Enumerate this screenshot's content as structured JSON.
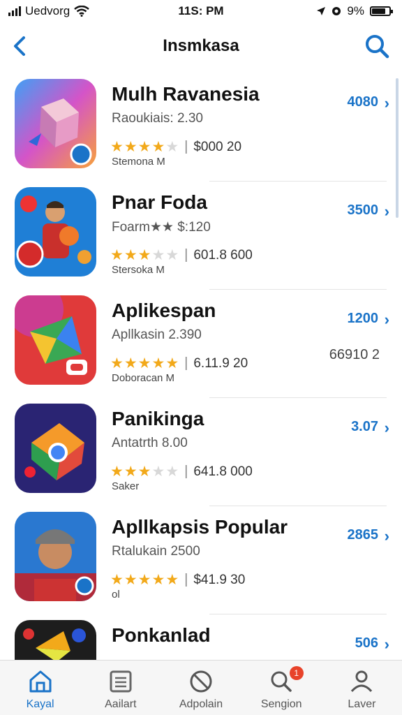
{
  "status_bar": {
    "carrier": "Uedvorg",
    "time": "11S: PM",
    "battery_text": "9%",
    "battery_level_fraction": 0.8
  },
  "header": {
    "title": "Insmkasa",
    "back_icon": "chevron-left-icon",
    "search_icon": "search-icon"
  },
  "apps": [
    {
      "name": "Mulh Ravanesia",
      "subtitle": "Raoukiais:  2.30",
      "stars": 4.5,
      "price": "$000  20",
      "category": "Stemona  M",
      "count": "4080",
      "extra": "",
      "icon_name": "cube-app-icon"
    },
    {
      "name": "Pnar Foda",
      "subtitle": "Foarm★★  $:120",
      "stars": 3,
      "price": "601.8  600",
      "category": "Stersoka  M",
      "count": "3500",
      "extra": "",
      "icon_name": "character-app-icon"
    },
    {
      "name": "Aplikespan",
      "subtitle": "Apllkasin  2.390",
      "stars": 5,
      "price": "6.11.9  20",
      "category": "Doboracan  M",
      "count": "1200",
      "extra": "66910 2",
      "icon_name": "triangle-app-icon"
    },
    {
      "name": "Panikinga",
      "subtitle": "Antatrth  8.00",
      "stars": 3.5,
      "price": "641.8  000",
      "category": "Saker",
      "count": "3.07",
      "extra": "",
      "icon_name": "cube-chrome-app-icon"
    },
    {
      "name": "Apllkapsis Popular",
      "subtitle": "Rtalukain  2500",
      "stars": 5,
      "price": "$41.9  30",
      "category": "ol",
      "count": "2865",
      "extra": "",
      "icon_name": "portrait-app-icon"
    },
    {
      "name": "Ponkanlad",
      "subtitle": "",
      "stars": 0,
      "price": "",
      "category": "",
      "count": "506",
      "extra": "",
      "icon_name": "bird-app-icon"
    }
  ],
  "tabs": [
    {
      "label": "Kayal",
      "icon": "home-icon",
      "active": true,
      "badge": ""
    },
    {
      "label": "Aailart",
      "icon": "list-icon",
      "active": false,
      "badge": ""
    },
    {
      "label": "Adpolain",
      "icon": "no-entry-icon",
      "active": false,
      "badge": ""
    },
    {
      "label": "Sengion",
      "icon": "search-icon",
      "active": false,
      "badge": "1"
    },
    {
      "label": "Laver",
      "icon": "profile-icon",
      "active": false,
      "badge": ""
    }
  ],
  "colors": {
    "accent": "#1a73c8",
    "star": "#f2a91a",
    "badge": "#e8432a"
  }
}
